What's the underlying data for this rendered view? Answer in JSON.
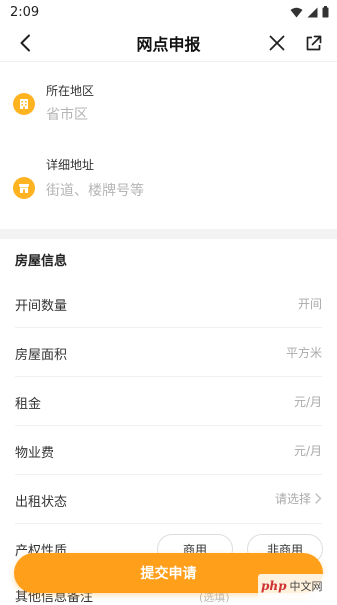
{
  "status_bar": {
    "time": "2:09"
  },
  "nav": {
    "title": "网点申报"
  },
  "address": {
    "region_label": "所在地区",
    "region_placeholder": "省市区",
    "detail_label": "详细地址",
    "detail_placeholder": "街道、楼牌号等"
  },
  "house_info": {
    "section_title": "房屋信息",
    "rows": [
      {
        "label": "开间数量",
        "value": "开间"
      },
      {
        "label": "房屋面积",
        "value": "平方米"
      },
      {
        "label": "租金",
        "value": "元/月"
      },
      {
        "label": "物业费",
        "value": "元/月"
      },
      {
        "label": "出租状态",
        "value": "请选择"
      },
      {
        "label": "产权性质"
      }
    ],
    "property_options": [
      "商用",
      "非商用"
    ],
    "other_info_label": "其他信息备注",
    "other_info_hint": "(选填)"
  },
  "submit_label": "提交申请",
  "watermark": {
    "logo": "php",
    "text": "中文网"
  },
  "colors": {
    "accent": "#ff9f1a",
    "icon_bg": "#ffb320"
  }
}
